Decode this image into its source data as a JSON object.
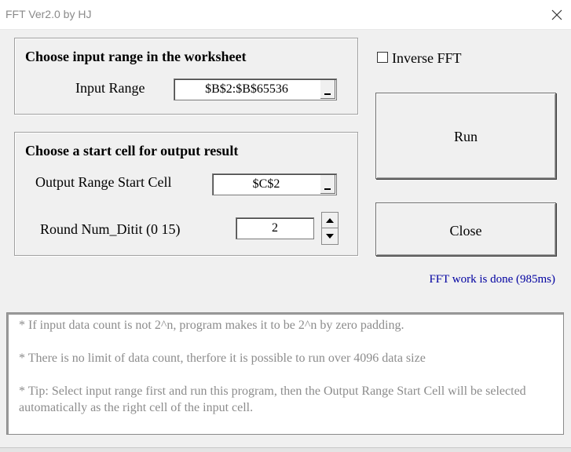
{
  "window": {
    "title": "FFT Ver2.0 by HJ"
  },
  "input_section": {
    "heading": "Choose input range in the worksheet",
    "range_label": "Input Range",
    "range_value": "$B$2:$B$65536"
  },
  "output_section": {
    "heading": "Choose a start cell  for output result",
    "start_label": "Output Range Start Cell",
    "start_value": "$C$2",
    "round_label": "Round Num_Ditit (0 15)",
    "round_value": "2"
  },
  "options": {
    "inverse_label": "Inverse FFT",
    "inverse_checked": false
  },
  "buttons": {
    "run_label": "Run",
    "close_label": "Close"
  },
  "status": {
    "text": "FFT work is done (985ms)",
    "color": "#0000a0"
  },
  "notes": {
    "line1": "* If input data count  is not 2^n, program makes it to be 2^n by zero padding.",
    "line2": "* There is no limit of data count, therfore it is possible to run over 4096 data size",
    "line3": "* Tip: Select input range first and run this program, then the Output Range Start Cell will be selected automatically as the right cell of the input cell."
  },
  "icons": {
    "close": "close-icon",
    "dropdown": "dropdown-icon",
    "spin_up": "arrow-up-icon",
    "spin_down": "arrow-down-icon"
  }
}
